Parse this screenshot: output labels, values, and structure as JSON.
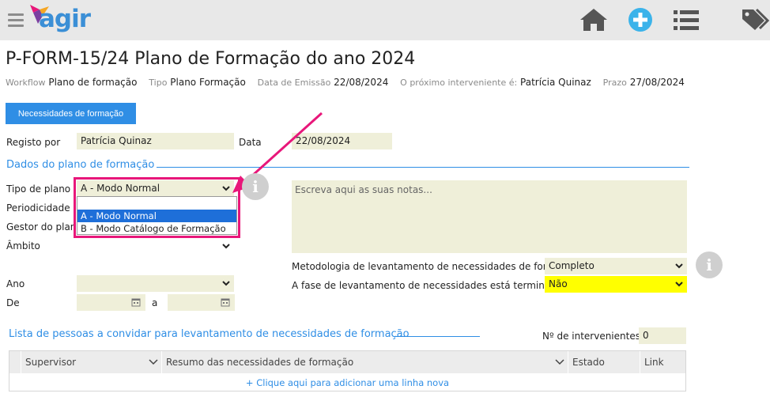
{
  "app": {
    "logo_text": "agir",
    "colors": {
      "accent": "#2f8ee5",
      "field_bg": "#efefd9",
      "highlight": "#e8177a",
      "warning_field": "#ffff00"
    }
  },
  "topbar": {
    "icons": [
      "menu-icon",
      "home-icon",
      "add-icon",
      "list-icon",
      "tag-icon"
    ]
  },
  "header": {
    "title": "P-FORM-15/24 Plano de Formação do ano 2024",
    "workflow_label": "Workflow",
    "workflow_value": "Plano de formação",
    "tipo_label": "Tipo",
    "tipo_value": "Plano Formação",
    "emissao_label": "Data de Emissão",
    "emissao_value": "22/08/2024",
    "interveniente_label": "O próximo interveniente é:",
    "interveniente_value": "Patrícia Quinaz",
    "prazo_label": "Prazo",
    "prazo_value": "27/08/2024"
  },
  "main_button": "Necessidades de formação",
  "registo": {
    "label": "Registo por",
    "value": "Patrícia Quinaz",
    "data_label": "Data",
    "data_value": "22/08/2024"
  },
  "section1": {
    "title": "Dados do plano de formação"
  },
  "form": {
    "tipo_plano_label": "Tipo de plano",
    "tipo_plano_value": "A - Modo Normal",
    "periodicidade_label": "Periodicidade",
    "gestor_label": "Gestor do plano",
    "ambito_label": "Âmbito",
    "ano_label": "Ano",
    "de_label": "De",
    "a_label": "a"
  },
  "dropdown": {
    "options": [
      "A - Modo Normal",
      "B - Modo Catálogo de Formação"
    ],
    "selected": 0
  },
  "notes": {
    "placeholder": "Escreva aqui as suas notas..."
  },
  "metodologia": {
    "label": "Metodologia de levantamento de necessidades de formação",
    "value": "Completo"
  },
  "fase": {
    "label": "A fase de levantamento de necessidades está terminada?",
    "value": "Não"
  },
  "section2": {
    "title": "Lista de pessoas a convidar para levantamento de necessidades de formação"
  },
  "intervenientes": {
    "label": "Nº de intervenientes",
    "value": "0"
  },
  "table": {
    "columns": [
      "Supervisor",
      "Resumo das necessidades de formação",
      "Estado",
      "Link"
    ],
    "add_row": "+ Clique aqui para adicionar uma linha nova"
  }
}
